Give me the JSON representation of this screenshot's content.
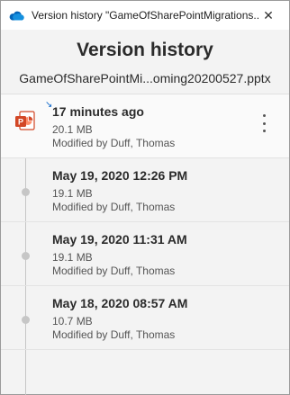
{
  "window": {
    "title": "Version history \"GameOfSharePointMigrations...",
    "close_symbol": "✕"
  },
  "header": {
    "title": "Version history",
    "file_name": "GameOfSharePointMi...oming20200527.pptx"
  },
  "versions": [
    {
      "time": "17 minutes ago",
      "size": "20.1 MB",
      "modified_by": "Modified by Duff, Thomas",
      "icon": "powerpoint-file-icon"
    },
    {
      "time": "May 19, 2020 12:26 PM",
      "size": "19.1 MB",
      "modified_by": "Modified by Duff, Thomas",
      "icon": "timeline-dot"
    },
    {
      "time": "May 19, 2020 11:31 AM",
      "size": "19.1 MB",
      "modified_by": "Modified by Duff, Thomas",
      "icon": "timeline-dot"
    },
    {
      "time": "May 18, 2020 08:57 AM",
      "size": "10.7 MB",
      "modified_by": "Modified by Duff, Thomas",
      "icon": "timeline-dot"
    }
  ],
  "colors": {
    "onedrive_blue": "#0364b8",
    "powerpoint_red": "#d24726",
    "background": "#f3f3f3",
    "timeline": "#c6c6c6"
  }
}
